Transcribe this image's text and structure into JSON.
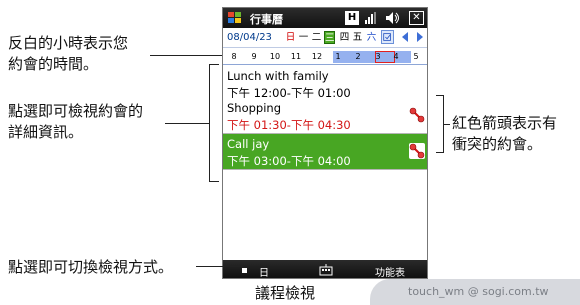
{
  "callouts": {
    "reverse_hours": "反白的小時表示您\n約會的時間。",
    "details": "點選即可檢視約會的\n詳細資訊。",
    "conflict": "紅色箭頭表示有\n衝突的約會。",
    "switch_view": "點選即可切換檢視方式。"
  },
  "titlebar": {
    "app_title": "行事曆",
    "icons": [
      "windows-logo-icon",
      "h-icon",
      "signal-icon",
      "volume-icon",
      "close-icon"
    ],
    "h_label": "H",
    "close_label": "✕"
  },
  "datebar": {
    "date": "08/04/23",
    "weekdays": [
      {
        "label": "日",
        "kind": "sun"
      },
      {
        "label": "一",
        "kind": "normal"
      },
      {
        "label": "二",
        "kind": "normal"
      },
      {
        "label": "三",
        "kind": "sel"
      },
      {
        "label": "四",
        "kind": "normal"
      },
      {
        "label": "五",
        "kind": "normal"
      },
      {
        "label": "六",
        "kind": "sat"
      }
    ]
  },
  "hourstrip": {
    "hours": [
      "8",
      "9",
      "10",
      "11",
      "12",
      "1",
      "2",
      "3",
      "4",
      "5"
    ]
  },
  "appointments": [
    {
      "title": "Lunch with family",
      "time": "下午 12:00-下午 01:00",
      "conflict": false,
      "selected": false
    },
    {
      "title": "Shopping",
      "time": "下午 01:30-下午 04:30",
      "conflict": true,
      "selected": false
    },
    {
      "title": "Call jay",
      "time": "下午 03:00-下午 04:00",
      "conflict": true,
      "selected": true
    }
  ],
  "softbar": {
    "left": "日",
    "right": "功能表"
  },
  "caption": "議程檢視",
  "watermark": "touch_wm  @ sogi.com.tw",
  "colors": {
    "selected_green": "#48a623",
    "conflict_red": "#d31616",
    "hour_block": "#95b1ef"
  }
}
